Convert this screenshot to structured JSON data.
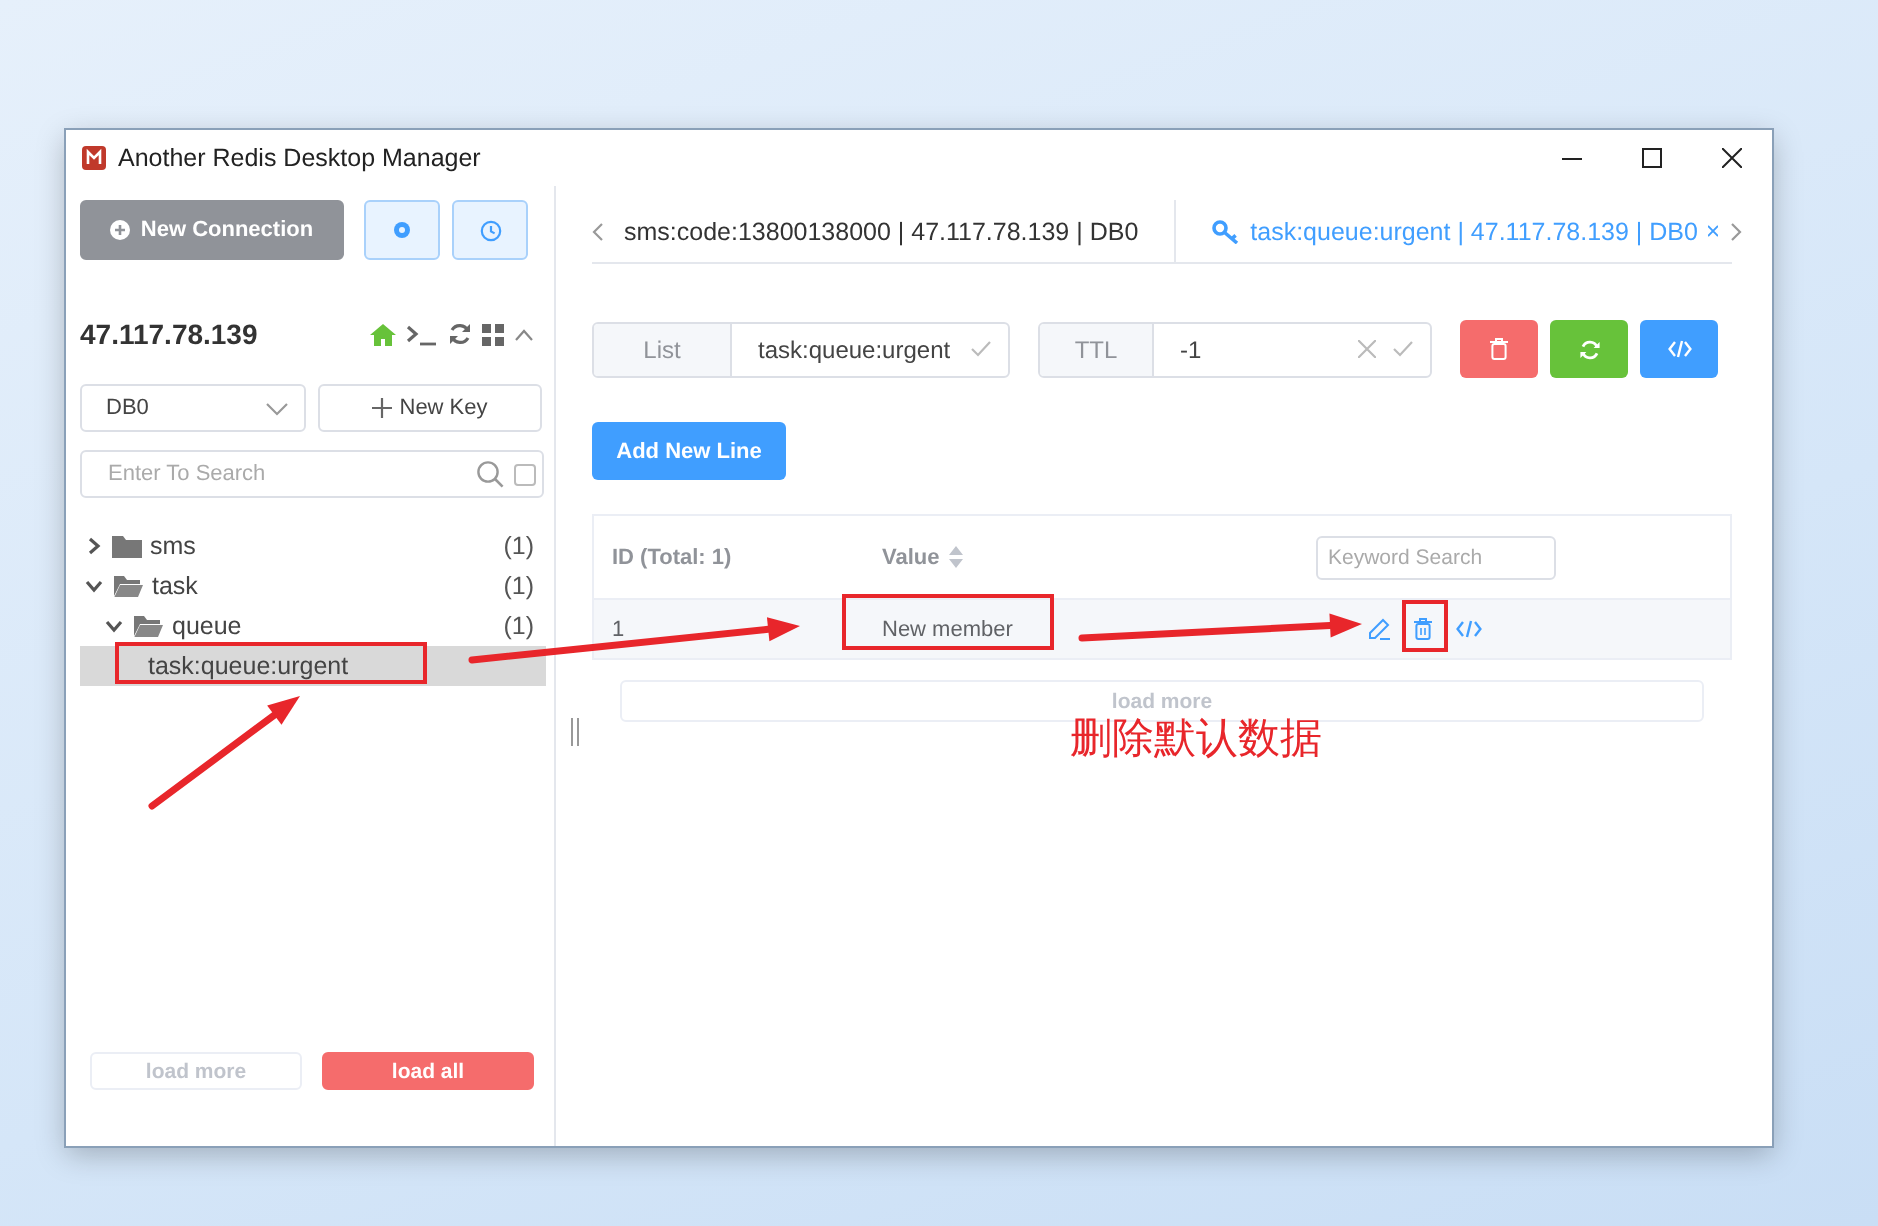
{
  "window": {
    "title": "Another Redis Desktop Manager"
  },
  "sidebar": {
    "new_connection": "New Connection",
    "host": "47.117.78.139",
    "db": "DB0",
    "new_key": "New Key",
    "search_placeholder": "Enter To Search",
    "exact_match": false,
    "tree": [
      {
        "kind": "folder",
        "name": "sms",
        "count": "(1)",
        "expanded": false,
        "selected": false
      },
      {
        "kind": "folder",
        "name": "task",
        "count": "(1)",
        "expanded": true,
        "selected": false,
        "children": [
          {
            "kind": "folder",
            "name": "queue",
            "count": "(1)",
            "expanded": true,
            "selected": false,
            "children": [
              {
                "kind": "key",
                "name": "task:queue:urgent",
                "selected": true
              }
            ]
          }
        ]
      }
    ],
    "load_more": "load more",
    "load_all": "load all"
  },
  "tabs": [
    {
      "label": "sms:code:13800138000 | 47.117.78.139 | DB0",
      "selected": false
    },
    {
      "label": "task:queue:urgent | 47.117.78.139 | DB0",
      "selected": true
    }
  ],
  "key_bar": {
    "type": "List",
    "key_name": "task:queue:urgent",
    "ttl_label": "TTL",
    "ttl": "-1"
  },
  "add_button": "Add New Line",
  "table": {
    "columns": [
      "ID (Total: 1)",
      "Value"
    ],
    "search_placeholder": "Keyword Search",
    "rows": [
      {
        "id": "1",
        "value": "New member"
      }
    ],
    "load_more": "load more"
  },
  "annotation": {
    "text": "删除默认数据"
  }
}
